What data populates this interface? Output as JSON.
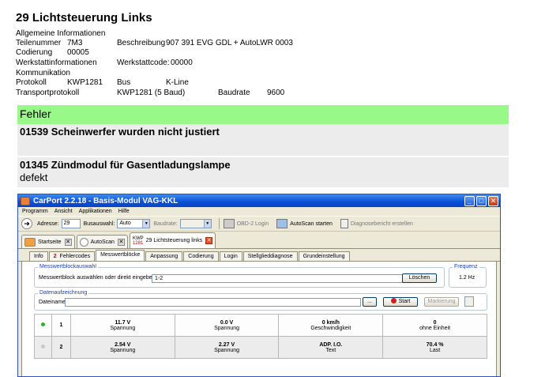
{
  "report": {
    "title": "29 Lichtsteuerung Links",
    "general_heading": "Allgemeine Informationen",
    "part_number_label": "Teilenummer",
    "part_number": "7M3",
    "description_label": "Beschreibung",
    "description": "907 391 EVG GDL + AutoLWR  0003",
    "coding_label": "Codierung",
    "coding": "00005",
    "workshop_label": "Werkstattinformationen",
    "workshop_code_label": "Werkstattcode:",
    "workshop_code": "00000",
    "communication_heading": "Kommunikation",
    "protocol_label": "Protokoll",
    "protocol": "KWP1281",
    "bus_label": "Bus",
    "bus": "K-Line",
    "transport_label": "Transportprotokoll",
    "transport": "KWP1281 (5 Baud)",
    "baud_label": "Baudrate",
    "baud": "9600"
  },
  "faults": {
    "heading": "Fehler",
    "items": [
      {
        "title": "01539 Scheinwerfer wurden nicht justiert",
        "detail": ""
      },
      {
        "title": "01345 Zündmodul für Gasentladungslampe",
        "detail": "defekt"
      }
    ]
  },
  "window": {
    "title": "CarPort 2.2.18 - Basis-Modul VAG-KKL",
    "buttons": [
      "_",
      "□",
      "✕"
    ],
    "menu": [
      "Programm",
      "Ansicht",
      "Applikationen",
      "Hilfe"
    ],
    "toolbar": {
      "address_label": "Adresse:",
      "address_value": "29",
      "bus_select_label": "Busauswahl:",
      "bus_select_value": "Auto",
      "baud_label": "Baudrate:",
      "obd_login": "OBD-2 Login",
      "autoscan_start": "AutoScan starten",
      "diag_report": "Diagnosebericht erstellen"
    },
    "module_tabs": {
      "home": "Startseite",
      "autoscan": "AutoScan",
      "kwp_top": "KWP",
      "kwp_bottom": "1281",
      "module": "29 Lichtsteuerung links"
    },
    "sub_tabs": {
      "info": "Info",
      "fault_count": "2",
      "fault_codes": "Fehlercodes",
      "measuring_blocks": "Messwertblöcke",
      "adaptation": "Anpassung",
      "coding": "Codierung",
      "login": "Login",
      "actuator": "Stellglieddiagnose",
      "basic_setting": "Grundeinstellung"
    },
    "mwb": {
      "group_label": "Messwertblockauswahl",
      "select_label": "Messwertblock auswählen oder direkt eingeben:",
      "select_value": "1-2",
      "delete_button": "Löschen",
      "freq_label": "Frequenz",
      "freq_value": "1.2 Hz"
    },
    "recording": {
      "group_label": "Datenaufzeichnung",
      "file_label": "Dateiname",
      "browse_button": "...",
      "start_button": "Start",
      "mark_button": "Markierung"
    },
    "table": {
      "rows": [
        {
          "active": true,
          "block": "1",
          "cells": [
            {
              "value": "11.7 V",
              "unit": "Spannung"
            },
            {
              "value": "0.0 V",
              "unit": "Spannung"
            },
            {
              "value": "0 km/h",
              "unit": "Geschwindigkeit"
            },
            {
              "value": "0",
              "unit": "ohne Einheit"
            }
          ]
        },
        {
          "active": false,
          "block": "2",
          "cells": [
            {
              "value": "2.54 V",
              "unit": "Spannung"
            },
            {
              "value": "2.27 V",
              "unit": "Spannung"
            },
            {
              "value": "ADP. I.O.",
              "unit": "Text"
            },
            {
              "value": "70.4 %",
              "unit": "Last"
            }
          ]
        }
      ]
    }
  }
}
